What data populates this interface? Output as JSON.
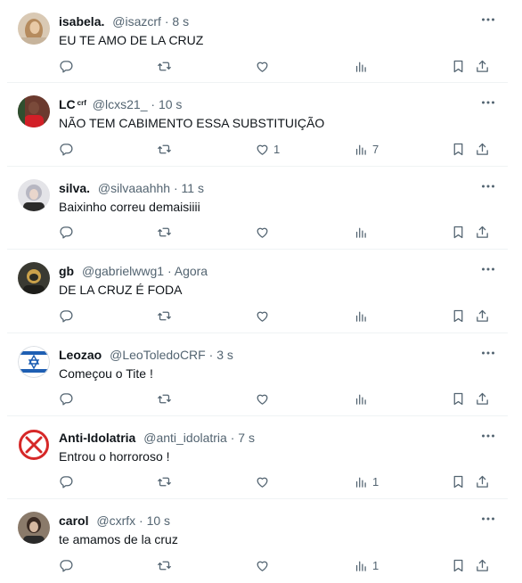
{
  "tweets": [
    {
      "name": "isabela.",
      "badge": "",
      "handle": "@isazcrf",
      "time": "8 s",
      "text": "EU TE AMO DE LA CRUZ",
      "likes": "",
      "views": "",
      "avatar": "avatar-isabela"
    },
    {
      "name": "LC",
      "badge": "crf",
      "handle": "@lcxs21_",
      "time": "10 s",
      "text": "NÃO TEM CABIMENTO ESSA SUBSTITUIÇÃO",
      "likes": "1",
      "views": "7",
      "avatar": "avatar-lc"
    },
    {
      "name": "silva.",
      "badge": "",
      "handle": "@silvaaahhh",
      "time": "11 s",
      "text": "Baixinho correu demaisiiii",
      "likes": "",
      "views": "",
      "avatar": "avatar-silva"
    },
    {
      "name": "gb",
      "badge": "",
      "handle": "@gabrielwwg1",
      "time": "Agora",
      "text": "DE LA CRUZ É FODA",
      "likes": "",
      "views": "",
      "avatar": "avatar-gb"
    },
    {
      "name": "Leozao",
      "badge": "",
      "handle": "@LeoToledoCRF",
      "time": "3 s",
      "text": "Começou o Tite !",
      "likes": "",
      "views": "",
      "avatar": "avatar-israel-flag"
    },
    {
      "name": "Anti-Idolatria",
      "badge": "",
      "handle": "@anti_idolatria",
      "time": "7 s",
      "text": "Entrou o horroroso !",
      "likes": "",
      "views": "1",
      "avatar": "avatar-red-x"
    },
    {
      "name": "carol",
      "badge": "",
      "handle": "@cxrfx",
      "time": "10 s",
      "text": "te amamos de la cruz",
      "likes": "",
      "views": "1",
      "avatar": "avatar-carol"
    }
  ],
  "separator": "·",
  "icons": {
    "reply": "reply-icon",
    "retweet": "retweet-icon",
    "like": "like-icon",
    "views": "views-icon",
    "bookmark": "bookmark-icon",
    "share": "share-icon",
    "more": "more-icon"
  },
  "colors": {
    "text": "#0f1419",
    "secondary": "#536471",
    "divider": "#eff3f4"
  }
}
